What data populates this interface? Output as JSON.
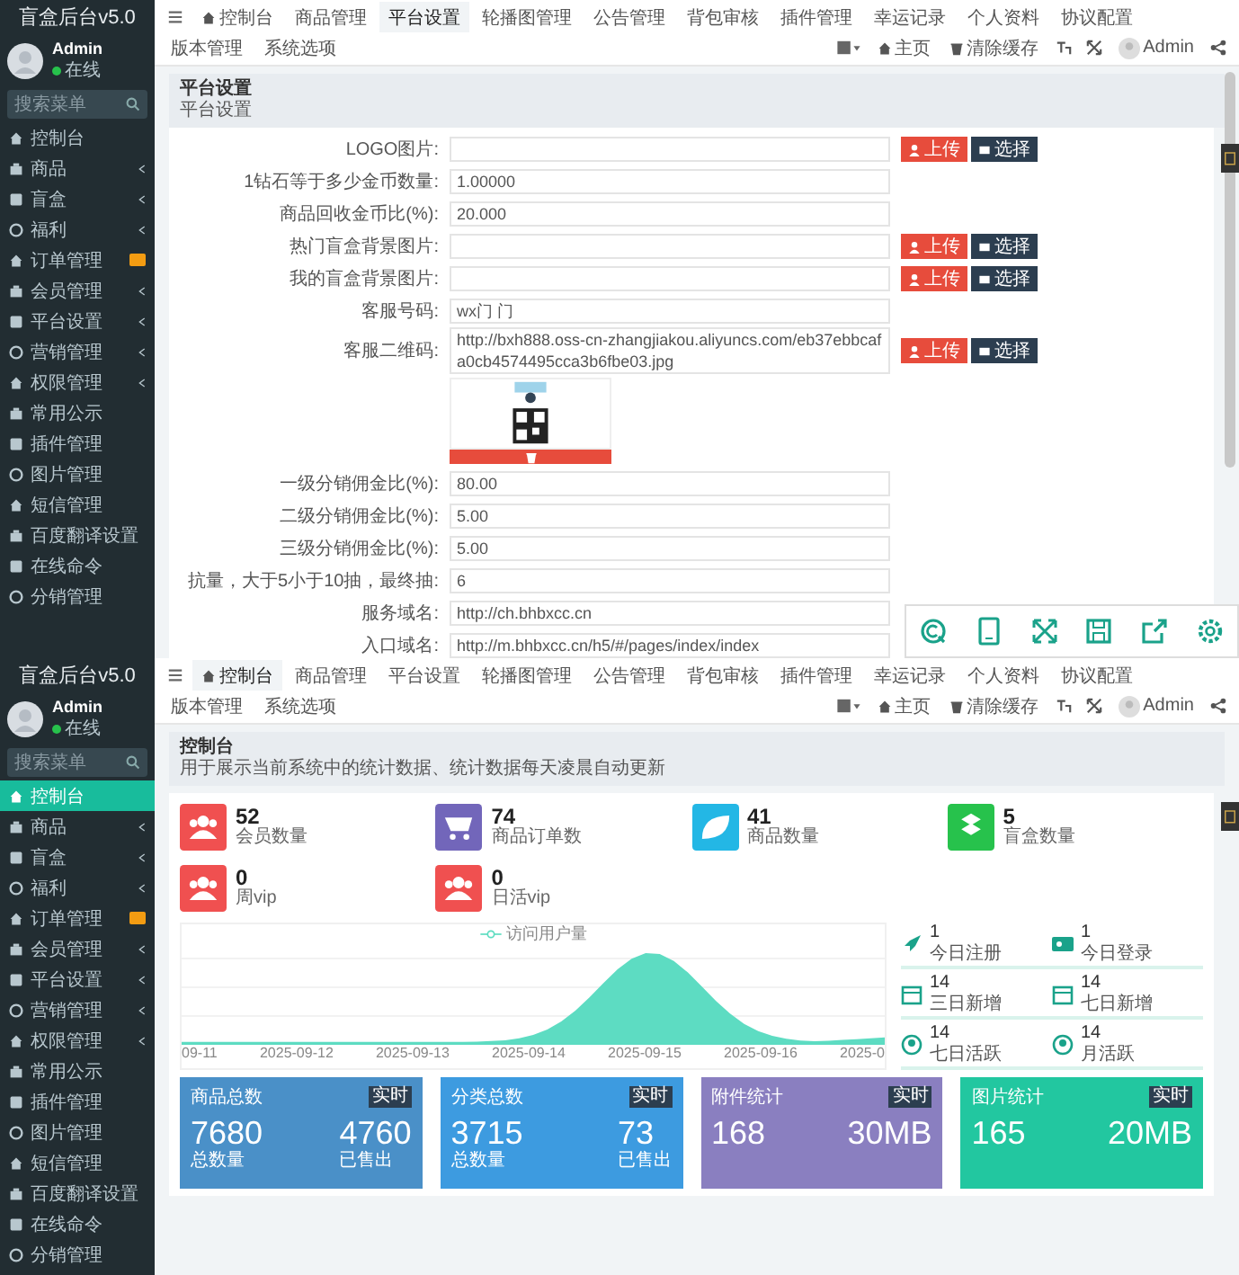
{
  "panels": [
    {
      "kind": "settings",
      "sidebar": {
        "title": "盲盒后台v5.0",
        "user": {
          "name": "Admin",
          "status": "在线"
        },
        "search_placeholder": "搜索菜单",
        "items": [
          {
            "label": "控制台",
            "has_submenu": false,
            "badge": false,
            "selected": false
          },
          {
            "label": "商品",
            "has_submenu": true,
            "badge": false,
            "selected": false
          },
          {
            "label": "盲盒",
            "has_submenu": true,
            "badge": false,
            "selected": false
          },
          {
            "label": "福利",
            "has_submenu": true,
            "badge": false,
            "selected": false
          },
          {
            "label": "订单管理",
            "has_submenu": false,
            "badge": true,
            "selected": false
          },
          {
            "label": "会员管理",
            "has_submenu": true,
            "badge": false,
            "selected": false
          },
          {
            "label": "平台设置",
            "has_submenu": true,
            "badge": false,
            "selected": false
          },
          {
            "label": "营销管理",
            "has_submenu": true,
            "badge": false,
            "selected": false
          },
          {
            "label": "权限管理",
            "has_submenu": true,
            "badge": false,
            "selected": false
          },
          {
            "label": "常用公示",
            "has_submenu": false,
            "badge": false,
            "selected": false
          },
          {
            "label": "插件管理",
            "has_submenu": false,
            "badge": false,
            "selected": false
          },
          {
            "label": "图片管理",
            "has_submenu": false,
            "badge": false,
            "selected": false
          },
          {
            "label": "短信管理",
            "has_submenu": false,
            "badge": false,
            "selected": false
          },
          {
            "label": "百度翻译设置",
            "has_submenu": false,
            "badge": false,
            "selected": false
          },
          {
            "label": "在线命令",
            "has_submenu": false,
            "badge": false,
            "selected": false
          },
          {
            "label": "分销管理",
            "has_submenu": false,
            "badge": false,
            "selected": false
          }
        ]
      },
      "topbar": {
        "tabs": [
          {
            "label": "控制台",
            "selected": false
          },
          {
            "label": "商品管理",
            "selected": false
          },
          {
            "label": "平台设置",
            "selected": true
          },
          {
            "label": "轮播图管理",
            "selected": false
          },
          {
            "label": "公告管理",
            "selected": false
          },
          {
            "label": "背包审核",
            "selected": false
          },
          {
            "label": "插件管理",
            "selected": false
          },
          {
            "label": "幸运记录",
            "selected": false
          },
          {
            "label": "个人资料",
            "selected": false
          },
          {
            "label": "协议配置",
            "selected": false
          },
          {
            "label": "版本管理",
            "selected": false
          },
          {
            "label": "系统选项",
            "selected": false
          }
        ],
        "home": "主页",
        "clear_cache": "清除缓存",
        "user": "Admin"
      },
      "header": {
        "title": "平台设置",
        "subtitle": "平台设置"
      },
      "form": {
        "rows": [
          {
            "kind": "upload",
            "label": "LOGO图片:",
            "upload_label": "上传",
            "choose_label": "选择"
          },
          {
            "kind": "text",
            "label": "1钻石等于多少金币数量:",
            "value": "1.00000"
          },
          {
            "kind": "text",
            "label": "商品回收金币比(%):",
            "value": "20.000"
          },
          {
            "kind": "upload",
            "label": "热门盲盒背景图片:",
            "upload_label": "上传",
            "choose_label": "选择"
          },
          {
            "kind": "upload",
            "label": "我的盲盒背景图片:",
            "upload_label": "上传",
            "choose_label": "选择"
          },
          {
            "kind": "text",
            "label": "客服号码:",
            "value": "wx门 门"
          },
          {
            "kind": "upload",
            "label": "客服二维码:",
            "value": "http://bxh888.oss-cn-zhangjiakou.aliyuncs.com/eb37ebbcafa0cb4574495cca3b6fbe03.jpg",
            "upload_label": "上传",
            "choose_label": "选择"
          },
          {
            "kind": "preview"
          },
          {
            "kind": "text",
            "label": "一级分销佣金比(%):",
            "value": "80.00"
          },
          {
            "kind": "text",
            "label": "二级分销佣金比(%):",
            "value": "5.00"
          },
          {
            "kind": "text",
            "label": "三级分销佣金比(%):",
            "value": "5.00"
          },
          {
            "kind": "text",
            "label": "抗量，大于5小于10抽，最终抽:",
            "value": "6"
          },
          {
            "kind": "text",
            "label": "服务域名:",
            "value": "http://ch.bhbxcc.cn"
          },
          {
            "kind": "text",
            "label": "入口域名:",
            "value": "http://m.bhbxcc.cn/h5/#/pages/index/index"
          }
        ]
      }
    },
    {
      "kind": "dashboard",
      "sidebar": {
        "title": "盲盒后台v5.0",
        "user": {
          "name": "Admin",
          "status": "在线"
        },
        "search_placeholder": "搜索菜单",
        "items": [
          {
            "label": "控制台",
            "has_submenu": false,
            "badge": false,
            "selected": true
          },
          {
            "label": "商品",
            "has_submenu": true,
            "badge": false,
            "selected": false
          },
          {
            "label": "盲盒",
            "has_submenu": true,
            "badge": false,
            "selected": false
          },
          {
            "label": "福利",
            "has_submenu": true,
            "badge": false,
            "selected": false
          },
          {
            "label": "订单管理",
            "has_submenu": false,
            "badge": true,
            "selected": false
          },
          {
            "label": "会员管理",
            "has_submenu": true,
            "badge": false,
            "selected": false
          },
          {
            "label": "平台设置",
            "has_submenu": true,
            "badge": false,
            "selected": false
          },
          {
            "label": "营销管理",
            "has_submenu": true,
            "badge": false,
            "selected": false
          },
          {
            "label": "权限管理",
            "has_submenu": true,
            "badge": false,
            "selected": false
          },
          {
            "label": "常用公示",
            "has_submenu": false,
            "badge": false,
            "selected": false
          },
          {
            "label": "插件管理",
            "has_submenu": false,
            "badge": false,
            "selected": false
          },
          {
            "label": "图片管理",
            "has_submenu": false,
            "badge": false,
            "selected": false
          },
          {
            "label": "短信管理",
            "has_submenu": false,
            "badge": false,
            "selected": false
          },
          {
            "label": "百度翻译设置",
            "has_submenu": false,
            "badge": false,
            "selected": false
          },
          {
            "label": "在线命令",
            "has_submenu": false,
            "badge": false,
            "selected": false
          },
          {
            "label": "分销管理",
            "has_submenu": false,
            "badge": false,
            "selected": false
          }
        ]
      },
      "topbar": {
        "tabs": [
          {
            "label": "控制台",
            "selected": true
          },
          {
            "label": "商品管理",
            "selected": false
          },
          {
            "label": "平台设置",
            "selected": false
          },
          {
            "label": "轮播图管理",
            "selected": false
          },
          {
            "label": "公告管理",
            "selected": false
          },
          {
            "label": "背包审核",
            "selected": false
          },
          {
            "label": "插件管理",
            "selected": false
          },
          {
            "label": "幸运记录",
            "selected": false
          },
          {
            "label": "个人资料",
            "selected": false
          },
          {
            "label": "协议配置",
            "selected": false
          },
          {
            "label": "版本管理",
            "selected": false
          },
          {
            "label": "系统选项",
            "selected": false
          }
        ],
        "home": "主页",
        "clear_cache": "清除缓存",
        "user": "Admin"
      },
      "header": {
        "title": "控制台",
        "subtitle": "用于展示当前系统中的统计数据、统计数据每天凌晨自动更新"
      },
      "stats": [
        {
          "value": "52",
          "label": "会员数量",
          "color": "#f05050"
        },
        {
          "value": "74",
          "label": "商品订单数",
          "color": "#7266ba"
        },
        {
          "value": "41",
          "label": "商品数量",
          "color": "#23b7e5"
        },
        {
          "value": "5",
          "label": "盲盒数量",
          "color": "#27c24c"
        },
        {
          "value": "0",
          "label": "周vip",
          "color": "#f05050"
        },
        {
          "value": "0",
          "label": "日活vip",
          "color": "#f05050"
        }
      ],
      "chart": {
        "legend": "访问用户量",
        "x_labels": [
          "09-11",
          "2025-09-12",
          "2025-09-13",
          "2025-09-14",
          "2025-09-15",
          "2025-09-16",
          "2025-0"
        ]
      },
      "summary": [
        {
          "value": "1",
          "label": "今日注册"
        },
        {
          "value": "1",
          "label": "今日登录"
        },
        {
          "value": "14",
          "label": "三日新增"
        },
        {
          "value": "14",
          "label": "七日新增"
        },
        {
          "value": "14",
          "label": "七日活跃"
        },
        {
          "value": "14",
          "label": "月活跃"
        }
      ],
      "cards": [
        {
          "title": "商品总数",
          "badge": "实时",
          "color": "#4a90c8",
          "values": [
            {
              "value": "7680",
              "label": "总数量"
            },
            {
              "value": "4760",
              "label": "已售出"
            }
          ]
        },
        {
          "title": "分类总数",
          "badge": "实时",
          "color": "#3d9be0",
          "values": [
            {
              "value": "3715",
              "label": "总数量"
            },
            {
              "value": "73",
              "label": "已售出"
            }
          ]
        },
        {
          "title": "附件统计",
          "badge": "实时",
          "color": "#8a7fc0",
          "values": [
            {
              "value": "168"
            },
            {
              "value": "30MB"
            }
          ]
        },
        {
          "title": "图片统计",
          "badge": "实时",
          "color": "#22c7a0",
          "values": [
            {
              "value": "165"
            },
            {
              "value": "20MB"
            }
          ]
        }
      ]
    }
  ]
}
